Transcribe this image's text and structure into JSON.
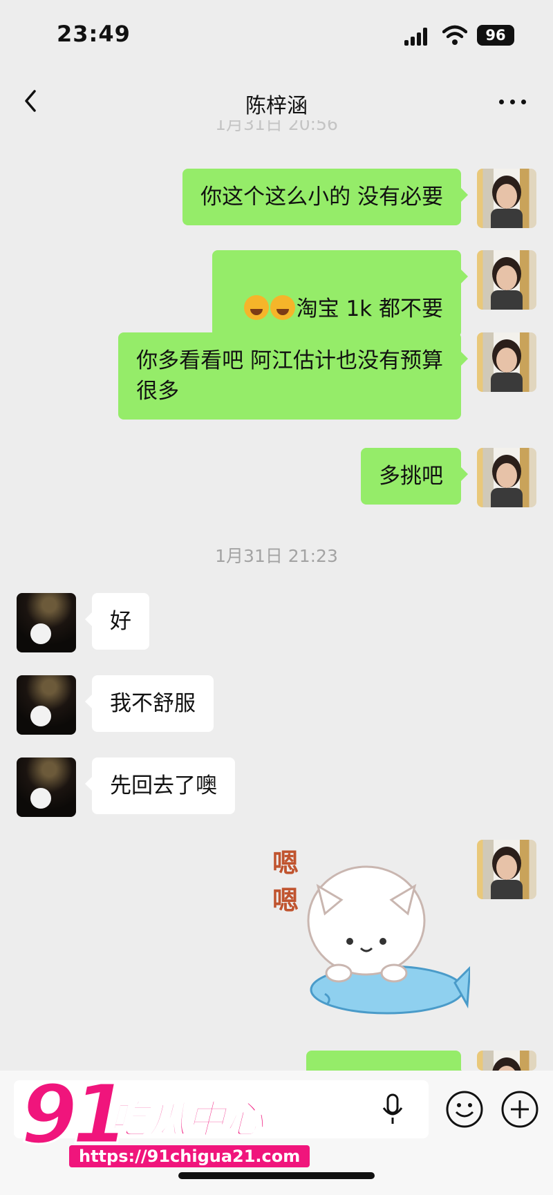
{
  "status_bar": {
    "time": "23:49",
    "battery": "96"
  },
  "header": {
    "title": "陈梓涵"
  },
  "timestamps": {
    "faded": "1月31日 20:56",
    "second": "1月31日 21:23"
  },
  "messages": {
    "m1": "你这个这么小的 没有必要",
    "m2": "淘宝 1k 都不要",
    "m3": "你多看看吧 阿江估计也没有预算\n很多",
    "m4": "多挑吧",
    "r1": "好",
    "r2": "我不舒服",
    "r3": "先回去了噢"
  },
  "sticker": {
    "text": "嗯\n嗯"
  },
  "watermark": {
    "number": "91",
    "name": "吃瓜中心",
    "url": "https://91chigua21.com"
  },
  "icons": [
    "back-icon",
    "more-icon",
    "laughing-tears-emoji",
    "mic-icon",
    "emoji-icon",
    "plus-icon"
  ],
  "colors": {
    "outgoing_bubble": "#95ec69",
    "incoming_bubble": "#ffffff",
    "background": "#ededed",
    "watermark": "#f0157c"
  }
}
